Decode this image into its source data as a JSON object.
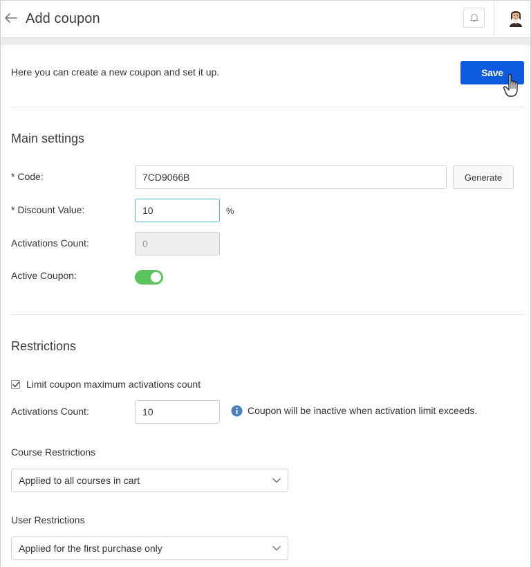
{
  "header": {
    "title": "Add coupon",
    "back_icon": "arrow-left-icon",
    "notifications_icon": "bell-icon",
    "avatar_icon": "user-avatar"
  },
  "intro": {
    "text": "Here you can create a new coupon and set it up.",
    "save_label": "Save"
  },
  "main_settings": {
    "title": "Main settings",
    "code_label": "* Code:",
    "code_value": "7CD9066B",
    "generate_label": "Generate",
    "discount_label": "* Discount Value:",
    "discount_value": "10",
    "discount_unit": "%",
    "activations_label": "Activations Count:",
    "activations_placeholder": "0",
    "active_label": "Active Coupon:",
    "active_on": true
  },
  "restrictions": {
    "title": "Restrictions",
    "limit_checkbox_label": "Limit coupon maximum activations count",
    "limit_checked": true,
    "activations_label": "Activations Count:",
    "activations_value": "10",
    "info_text": "Coupon will be inactive when activation limit exceeds.",
    "course_label": "Course Restrictions",
    "course_value": "Applied to all courses in cart",
    "user_label": "User Restrictions",
    "user_value": "Applied for the first purchase only"
  },
  "colors": {
    "primary": "#0f5be0",
    "toggle_on": "#5cc45c",
    "focus_border": "#46b7c9",
    "info": "#4a7fbf"
  }
}
